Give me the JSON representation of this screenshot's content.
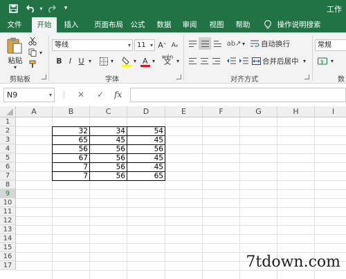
{
  "title_bar": {
    "title": "工作",
    "save_icon": "save-icon",
    "undo_icon": "undo-icon",
    "redo_icon": "redo-icon",
    "customize_icon": "customize-qat-icon"
  },
  "tabs": [
    {
      "label": "文件"
    },
    {
      "label": "开始"
    },
    {
      "label": "插入"
    },
    {
      "label": "页面布局"
    },
    {
      "label": "公式"
    },
    {
      "label": "数据"
    },
    {
      "label": "审阅"
    },
    {
      "label": "视图"
    },
    {
      "label": "帮助"
    },
    {
      "label": "操作说明搜索"
    }
  ],
  "active_tab": "开始",
  "ribbon": {
    "clipboard": {
      "paste_label": "粘贴",
      "group_label": "剪贴板"
    },
    "font": {
      "font_name": "等线",
      "font_size": "11",
      "bold": "B",
      "italic": "I",
      "underline": "U",
      "phonetic": "wén",
      "group_label": "字体"
    },
    "alignment": {
      "wrap_text": "自动换行",
      "merge_center": "合并后居中",
      "group_label": "对齐方式"
    },
    "number": {
      "format": "常规",
      "group_label": "数"
    }
  },
  "formula_bar": {
    "name_box": "N9",
    "cancel": "✕",
    "enter": "✓",
    "fx": "fx",
    "value": ""
  },
  "sheet": {
    "columns": [
      "A",
      "B",
      "C",
      "D",
      "E",
      "F",
      "G",
      "H",
      "I"
    ],
    "rows": [
      "1",
      "2",
      "3",
      "4",
      "5",
      "6",
      "7",
      "8",
      "9",
      "10",
      "11",
      "12",
      "13",
      "14",
      "15",
      "16",
      "17"
    ],
    "selected_row": "9",
    "data": [
      [
        "32",
        "34",
        "54"
      ],
      [
        "65",
        "45",
        "45"
      ],
      [
        "56",
        "56",
        "56"
      ],
      [
        "67",
        "56",
        "45"
      ],
      [
        "7",
        "56",
        "45"
      ],
      [
        "7",
        "56",
        "65"
      ]
    ]
  },
  "watermark": "7tdown.com",
  "colors": {
    "accent": "#217346",
    "ribbon_bg": "#f3f3f3",
    "font_color_bar": "#e81123",
    "highlight_bar": "#ffff00"
  }
}
